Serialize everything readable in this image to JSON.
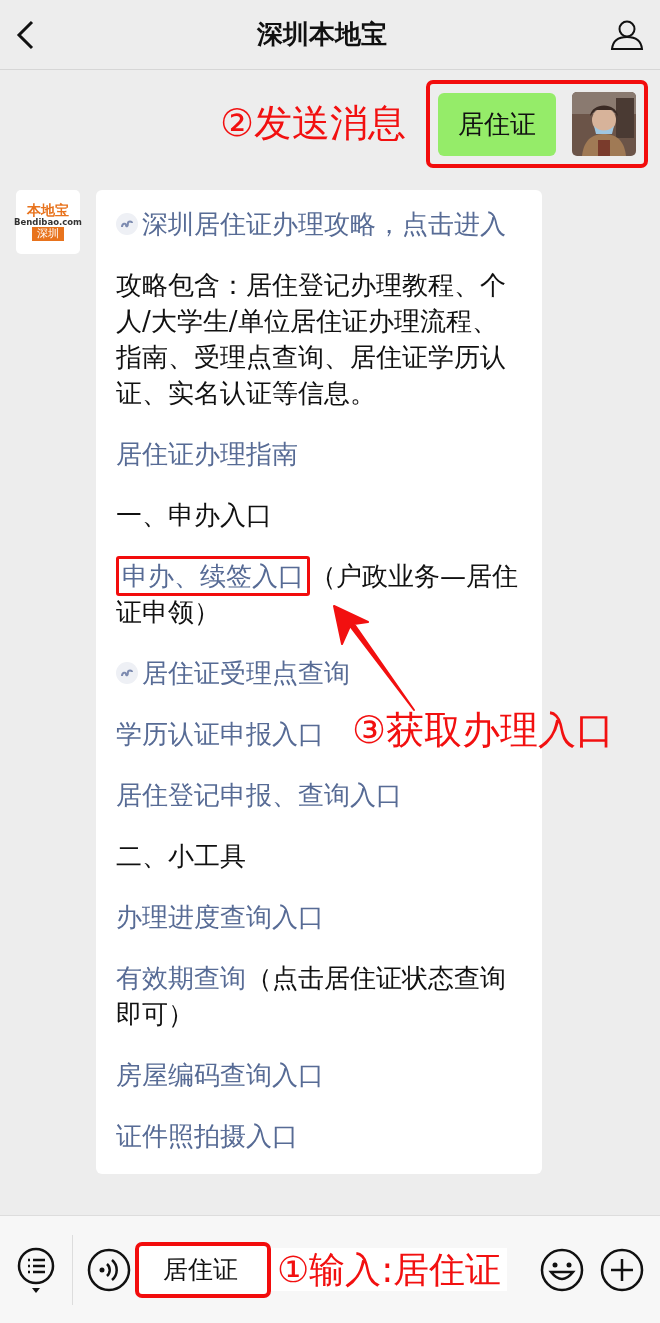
{
  "header": {
    "title": "深圳本地宝"
  },
  "sent": {
    "text": "居住证",
    "boxed": true,
    "annotation": "②发送消息"
  },
  "received": {
    "logo": {
      "brand": "本地宝",
      "domain": "Bendibao.com",
      "city": "深圳"
    },
    "paragraphs": [
      {
        "parts": [
          {
            "kind": "mini_link",
            "text": "深圳居住证办理攻略，点击进入",
            "boxed": false
          }
        ]
      },
      {
        "parts": [
          {
            "kind": "text",
            "text": "攻略包含：居住登记办理教程、个人/大学生/单位居住证办理流程、指南、受理点查询、居住证学历认证、实名认证等信息。",
            "boxed": false
          }
        ]
      },
      {
        "parts": [
          {
            "kind": "link",
            "text": "居住证办理指南",
            "boxed": false
          }
        ]
      },
      {
        "parts": [
          {
            "kind": "text",
            "text": "一、申办入口",
            "boxed": false
          }
        ]
      },
      {
        "parts": [
          {
            "kind": "link",
            "text": "申办、续签入口",
            "boxed": true,
            "annotation": "③获取办理入口"
          },
          {
            "kind": "text",
            "text": "（户政业务—居住证申领）",
            "boxed": false
          }
        ]
      },
      {
        "parts": [
          {
            "kind": "mini_link",
            "text": "居住证受理点查询",
            "boxed": false
          }
        ]
      },
      {
        "parts": [
          {
            "kind": "link",
            "text": "学历认证申报入口",
            "boxed": false
          }
        ]
      },
      {
        "parts": [
          {
            "kind": "link",
            "text": "居住登记申报、查询入口",
            "boxed": false
          }
        ]
      },
      {
        "parts": [
          {
            "kind": "text",
            "text": "二、小工具",
            "boxed": false
          }
        ]
      },
      {
        "parts": [
          {
            "kind": "link",
            "text": "办理进度查询入口",
            "boxed": false
          }
        ]
      },
      {
        "parts": [
          {
            "kind": "link",
            "text": "有效期查询",
            "boxed": false
          },
          {
            "kind": "text",
            "text": "（点击居住证状态查询即可）",
            "boxed": false
          }
        ]
      },
      {
        "parts": [
          {
            "kind": "link",
            "text": "房屋编码查询入口",
            "boxed": false
          }
        ]
      },
      {
        "parts": [
          {
            "kind": "link",
            "text": "证件照拍摄入口",
            "boxed": false
          }
        ]
      }
    ]
  },
  "input": {
    "value": "居住证",
    "boxed": true,
    "annotation": "①输入:居住证"
  }
}
